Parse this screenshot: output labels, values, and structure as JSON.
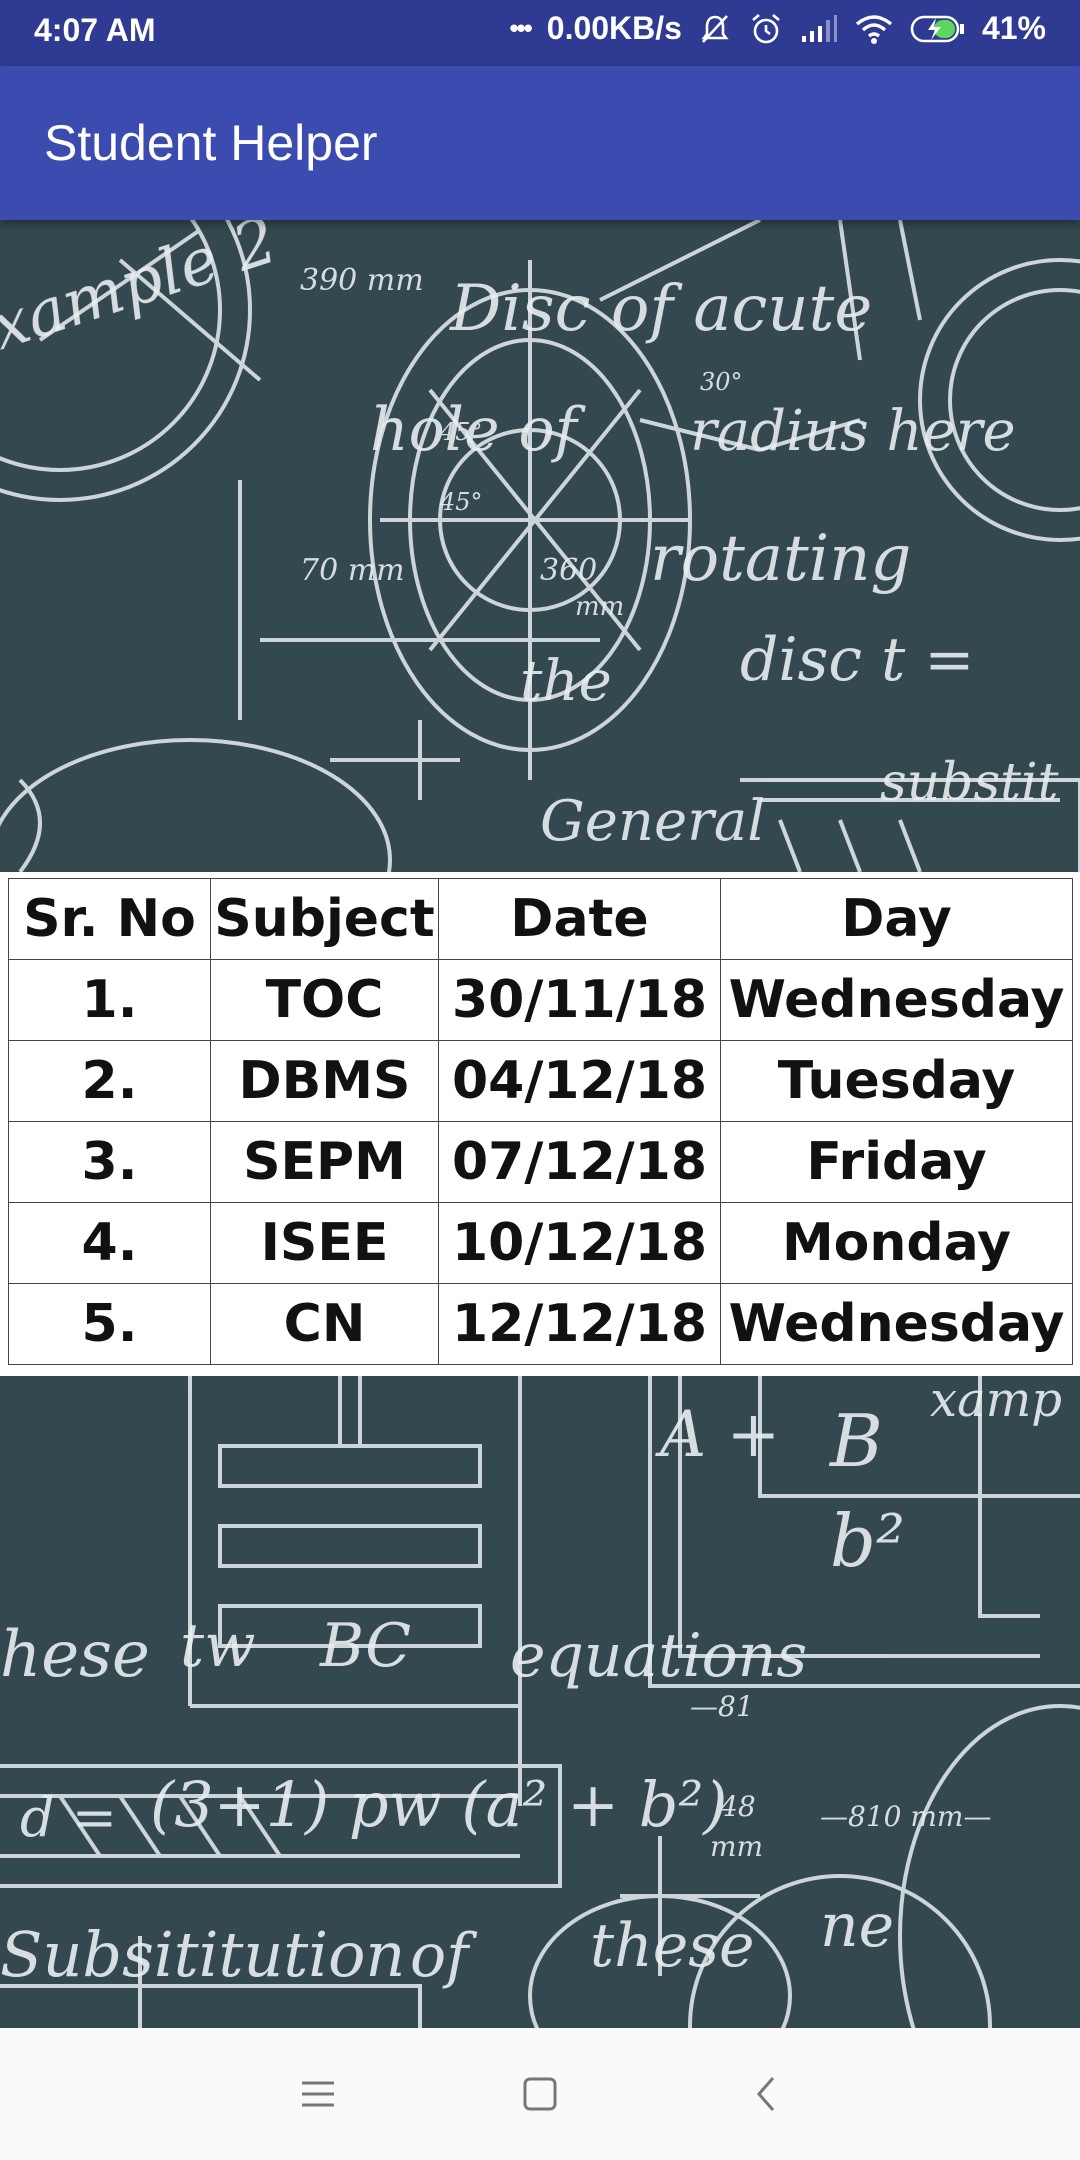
{
  "status_bar": {
    "time": "4:07 AM",
    "more": "•••",
    "net_speed": "0.00KB/s",
    "battery": "41%"
  },
  "app_bar": {
    "title": "Student Helper"
  },
  "exam_table": {
    "headers": [
      "Sr. No",
      "Subject",
      "Date",
      "Day"
    ],
    "rows": [
      [
        "1.",
        "TOC",
        "30/11/18",
        "Wednesday"
      ],
      [
        "2.",
        "DBMS",
        "04/12/18",
        "Tuesday"
      ],
      [
        "3.",
        "SEPM",
        "07/12/18",
        "Friday"
      ],
      [
        "4.",
        "ISEE",
        "10/12/18",
        "Monday"
      ],
      [
        "5.",
        "CN",
        "12/12/18",
        "Wednesday"
      ]
    ]
  },
  "nav_bar": {
    "icons": [
      "menu-icon",
      "home-icon",
      "back-icon"
    ]
  },
  "colors": {
    "status_bar": "#2f3a92",
    "app_bar": "#3b4bb0",
    "chalkboard": "#33494f"
  }
}
